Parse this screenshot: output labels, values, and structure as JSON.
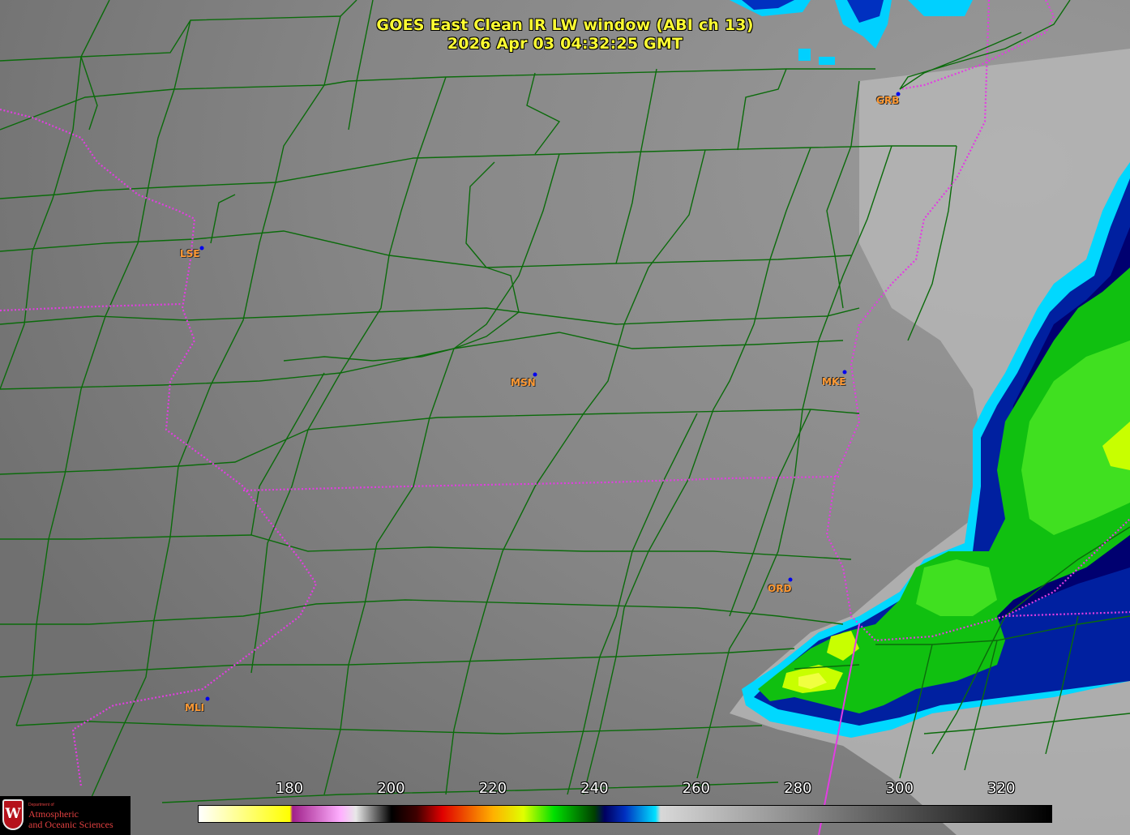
{
  "title": {
    "line1": "GOES East Clean IR LW window (ABI ch 13)",
    "line2": "2026 Apr 03  04:32:25 GMT"
  },
  "cities": [
    {
      "code": "GRB"
    },
    {
      "code": "LSE"
    },
    {
      "code": "MSN"
    },
    {
      "code": "MKE"
    },
    {
      "code": "ORD"
    },
    {
      "code": "MLI"
    }
  ],
  "colorbar": {
    "ticks": [
      "180",
      "200",
      "220",
      "240",
      "260",
      "280",
      "300",
      "320"
    ],
    "stops": [
      {
        "value": 162,
        "color": "#ffffff"
      },
      {
        "value": 180,
        "color": "#ffff00"
      },
      {
        "value": 180.5,
        "color": "#a0208a"
      },
      {
        "value": 190,
        "color": "#ffb0ff"
      },
      {
        "value": 193,
        "color": "#e8e8e8"
      },
      {
        "value": 200,
        "color": "#000000"
      },
      {
        "value": 205,
        "color": "#400000"
      },
      {
        "value": 210,
        "color": "#e00000"
      },
      {
        "value": 220,
        "color": "#ffb000"
      },
      {
        "value": 226,
        "color": "#e0ff00"
      },
      {
        "value": 232,
        "color": "#00e000"
      },
      {
        "value": 240,
        "color": "#004000"
      },
      {
        "value": 242,
        "color": "#000060"
      },
      {
        "value": 246,
        "color": "#0030c0"
      },
      {
        "value": 252,
        "color": "#00e0ff"
      },
      {
        "value": 253,
        "color": "#d8d8d8"
      },
      {
        "value": 330,
        "color": "#000000"
      }
    ],
    "min": 162,
    "max": 330
  },
  "logo": {
    "small": "Department of",
    "line1": "Atmospheric",
    "line2": "and Oceanic Sciences",
    "shield_letter": "W"
  },
  "colors": {
    "background": "#7a7a7a",
    "county_lines": "#0b6b0b",
    "state_lines": "#e23de2",
    "title": "#ffff33",
    "city_label": "#ff9933"
  }
}
